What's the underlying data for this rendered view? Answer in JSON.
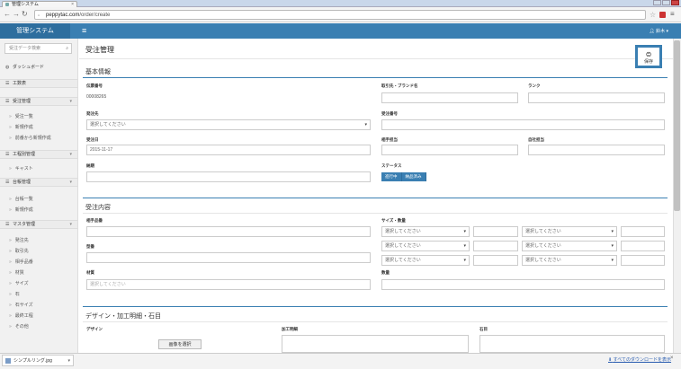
{
  "browser": {
    "tab_title": "管理システム",
    "url_domain": "peppytac.com",
    "url_path": "/order/create",
    "downloads_file": "シンプルリング.jpg",
    "downloads_show_all": "すべてのダウンロードを表示"
  },
  "header": {
    "brand": "管理システム",
    "user_name": "鈴木"
  },
  "sidebar": {
    "search_placeholder": "受注データ検索",
    "items": [
      {
        "label": "ダッシュボード"
      },
      {
        "label": "工数表"
      },
      {
        "label": "受注管理"
      },
      {
        "label": "受注一覧"
      },
      {
        "label": "新規作成"
      },
      {
        "label": "前番から新規作成"
      },
      {
        "label": "工程別管理"
      },
      {
        "label": "キャスト"
      },
      {
        "label": "台帳管理"
      },
      {
        "label": "台帳一覧"
      },
      {
        "label": "新規作成"
      },
      {
        "label": "マスタ管理"
      },
      {
        "label": "発注先"
      },
      {
        "label": "取引先"
      },
      {
        "label": "相手品番"
      },
      {
        "label": "材質"
      },
      {
        "label": "サイズ"
      },
      {
        "label": "石"
      },
      {
        "label": "石サイズ"
      },
      {
        "label": "最終工程"
      },
      {
        "label": "その他"
      }
    ]
  },
  "page": {
    "title": "受注管理",
    "save_label": "保存"
  },
  "basic_info": {
    "title": "基本情報",
    "order_no_label": "伝票番号",
    "order_no_value": "00008265",
    "brand_label": "取引先・ブランド名",
    "rank_label": "ランク",
    "supplier_label": "発注先",
    "select_placeholder": "選択してください",
    "order_number_label": "受注番号",
    "order_date_label": "受注日",
    "order_date_value": "2015-11-17",
    "partner_staff_label": "相手担当",
    "our_staff_label": "自社担当",
    "deadline_label": "納期",
    "status_label": "ステータス",
    "status_options": [
      "進行中",
      "納品済み"
    ]
  },
  "order_details": {
    "title": "受注内容",
    "partner_part_label": "相手品番",
    "size_qty_label": "サイズ・数量",
    "type_label": "型番",
    "material_label": "材質",
    "material_placeholder": "選択してください",
    "qty_label": "数量",
    "select_placeholder": "選択してください"
  },
  "design": {
    "title": "デザイン・加工明細・石目",
    "design_label": "デザイン",
    "process_label": "加工明細",
    "stone_label": "石目",
    "image_button": "画像を選択"
  }
}
